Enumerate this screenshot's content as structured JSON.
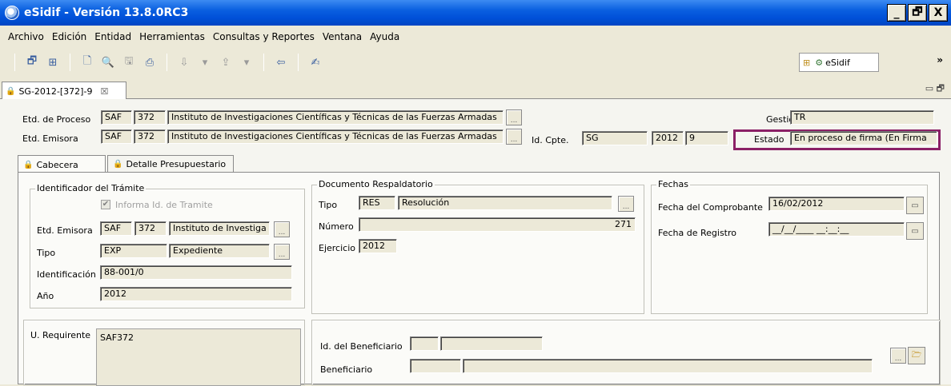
{
  "window": {
    "title": "eSidif - Versión 13.8.0RC3",
    "controls": [
      "_",
      "🗗",
      "X"
    ]
  },
  "menu": [
    "Archivo",
    "Edición",
    "Entidad",
    "Herramientas",
    "Consultas y Reportes",
    "Ventana",
    "Ayuda"
  ],
  "toolbar": {
    "perspective_label": "eSidif",
    "more": "»"
  },
  "editor_tab": {
    "label": "SG-2012-[372]-9",
    "close": "☒"
  },
  "header": {
    "etd_proceso_label": "Etd. de Proceso",
    "etd_proceso_saf": "SAF",
    "etd_proceso_code": "372",
    "etd_proceso_name": "Instituto de Investigaciones Científicas y Técnicas de las Fuerzas Armadas",
    "etd_emisora_label": "Etd. Emisora",
    "etd_emisora_saf": "SAF",
    "etd_emisora_code": "372",
    "etd_emisora_name": "Instituto de Investigaciones Científicas y Técnicas de las Fuerzas Armadas",
    "dots": "...",
    "id_cpte_label": "Id. Cpte.",
    "id_cpte_type": "SG",
    "id_cpte_year": "2012",
    "id_cpte_number": "9",
    "gestion_label": "Gestión",
    "gestion_value": "TR",
    "estado_label": "Estado",
    "estado_value": "En proceso de firma (En Firma"
  },
  "tabs": [
    "Cabecera",
    "Detalle Presupuestario"
  ],
  "tramite": {
    "title": "Identificador del Trámite",
    "informa_label": "Informa Id. de Tramite",
    "etd_emisora_label": "Etd. Emisora",
    "saf": "SAF",
    "code": "372",
    "name": "Instituto de Investiga",
    "tipo_label": "Tipo",
    "tipo_code": "EXP",
    "tipo_name": "Expediente",
    "identificacion_label": "Identificación",
    "identificacion_value": "88-001/0",
    "anio_label": "Año",
    "anio_value": "2012"
  },
  "documento": {
    "title": "Documento Respaldatorio",
    "tipo_label": "Tipo",
    "tipo_code": "RES",
    "tipo_name": "Resolución",
    "numero_label": "Número",
    "numero_value": "271",
    "ejercicio_label": "Ejercicio",
    "ejercicio_value": "2012"
  },
  "fechas": {
    "title": "Fechas",
    "comprobante_label": "Fecha del Comprobante",
    "comprobante_value": "16/02/2012",
    "registro_label": "Fecha de Registro",
    "registro_value": "__/__/____ __:__:__"
  },
  "requirente": {
    "label": "U. Requirente",
    "value": "SAF372"
  },
  "beneficiario": {
    "id_label": "Id. del Beneficiario",
    "label": "Beneficiario"
  },
  "colors": {
    "title_bar": "#0a5fe0",
    "estado_highlight": "#8b2066",
    "window_bg": "#ece9d8"
  }
}
